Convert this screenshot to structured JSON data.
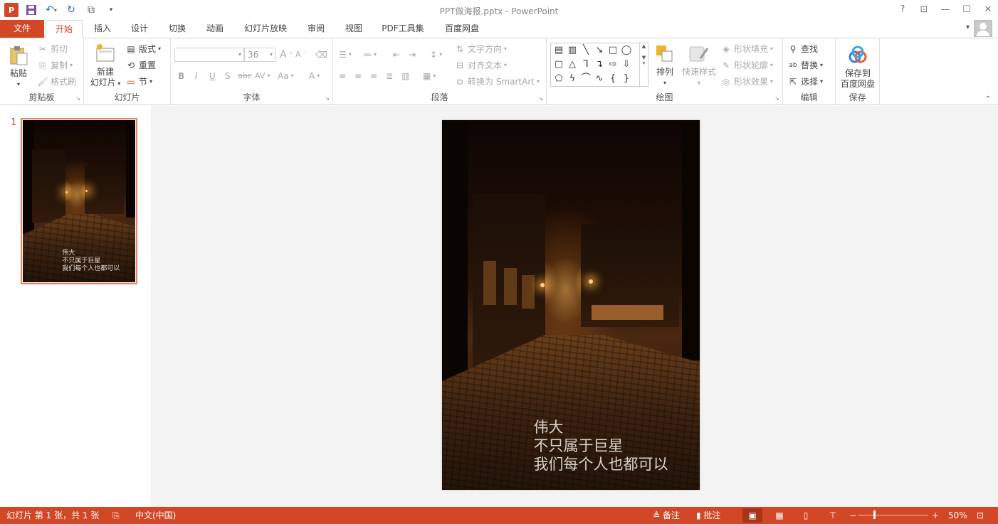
{
  "window": {
    "title": "PPT做海报.pptx - PowerPoint",
    "help": "?",
    "controls": [
      "?",
      "▭",
      "—",
      "☐",
      "✕"
    ]
  },
  "qat": {
    "logo": "P",
    "save_icon": "save-icon",
    "undo_icon": "undo-icon",
    "redo_icon": "redo-icon",
    "present_icon": "present-icon"
  },
  "tabs": [
    "文件",
    "开始",
    "插入",
    "设计",
    "切换",
    "动画",
    "幻灯片放映",
    "审阅",
    "视图",
    "PDF工具集",
    "百度网盘"
  ],
  "ribbon": {
    "clipboard": {
      "paste": "粘贴",
      "cut": "剪切",
      "copy": "复制",
      "painter": "格式刷",
      "label": "剪贴板"
    },
    "slides": {
      "new_slide_1": "新建",
      "new_slide_2": "幻灯片",
      "layout": "版式",
      "reset": "重置",
      "section": "节",
      "label": "幻灯片"
    },
    "font": {
      "font_name": "",
      "font_size": "36",
      "label": "字体",
      "bold": "B",
      "italic": "I",
      "underline": "U",
      "shadow": "S",
      "strike": "abc",
      "spacing": "AV",
      "case": "Aa",
      "color": "A",
      "grow": "A",
      "shrink": "A"
    },
    "paragraph": {
      "text_direction": "文字方向",
      "align_text": "对齐文本",
      "smartart": "转换为 SmartArt",
      "label": "段落"
    },
    "drawing": {
      "arrange": "排列",
      "quick_styles": "快速样式",
      "shape_fill": "形状填充",
      "shape_outline": "形状轮廓",
      "shape_effects": "形状效果",
      "label": "绘图"
    },
    "editing": {
      "find": "查找",
      "replace": "替换",
      "select": "选择",
      "label": "编辑"
    },
    "save": {
      "save_to_1": "保存到",
      "save_to_2": "百度网盘",
      "label": "保存"
    }
  },
  "thumbnails": [
    {
      "number": "1",
      "lines": [
        "伟大",
        "不只属于巨星",
        "我们每个人也都可以"
      ]
    }
  ],
  "slide": {
    "lines": [
      "伟大",
      "不只属于巨星",
      "我们每个人也都可以"
    ]
  },
  "status": {
    "slide_info": "幻灯片 第 1 张，共 1 张",
    "language": "中文(中国)",
    "notes": "备注",
    "comments": "批注",
    "zoom": "50%",
    "zoom_minus": "−",
    "zoom_plus": "+"
  },
  "colors": {
    "accent": "#d24726",
    "thumb_border": "#e88463"
  }
}
